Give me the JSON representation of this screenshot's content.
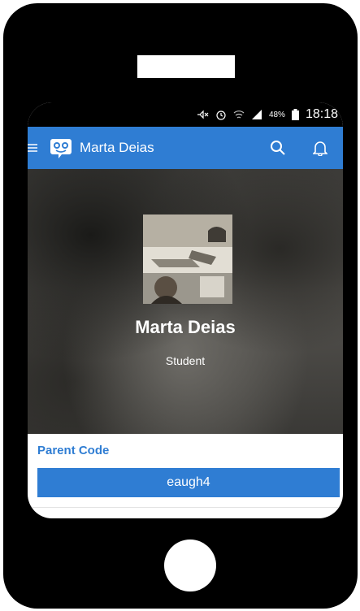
{
  "status_bar": {
    "battery_percent": "48%",
    "time": "18:18"
  },
  "app_bar": {
    "title": "Marta Deias",
    "icons": [
      "menu-icon",
      "classdojo-logo-icon",
      "search-icon",
      "bell-icon"
    ]
  },
  "profile": {
    "name": "Marta Deias",
    "role": "Student"
  },
  "parent_code": {
    "label": "Parent Code",
    "value": "eaugh4"
  },
  "colors": {
    "accent": "#2f7dd3",
    "frame": "#000000"
  }
}
